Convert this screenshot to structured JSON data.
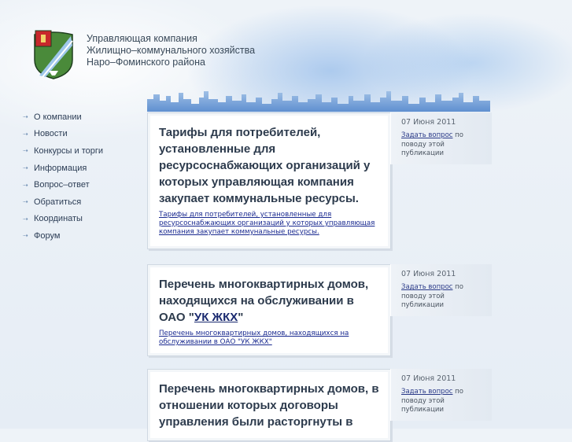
{
  "header": {
    "org_line1": "Управляющая компания",
    "org_line2": "Жилищно–коммунального хозяйства",
    "org_line3": "Наро–Фоминского района"
  },
  "nav": {
    "items": [
      {
        "label": "О компании"
      },
      {
        "label": "Новости"
      },
      {
        "label": "Конкурсы и торги"
      },
      {
        "label": "Информация"
      },
      {
        "label": "Вопрос–ответ"
      },
      {
        "label": "Обратиться"
      },
      {
        "label": "Координаты"
      },
      {
        "label": "Форум"
      }
    ]
  },
  "articles": [
    {
      "title": "Тарифы для потребителей, установленные для ресурсоснабжающих организаций у которых управляющая компания закупает коммунальные ресурсы.",
      "link": "Тарифы для потребителей, установленные для ресурсоснабжающих организаций у которых управляющая компания закупает коммунальные ресурсы.",
      "date": "07 Июня 2011",
      "ask_link": "Задать вопрос",
      "ask_rest": "по поводу этой публикации"
    },
    {
      "title_prefix": "Перечень многоквартирных домов, находящихся на обслуживании в ОАО \"",
      "title_link": "УК ЖКХ",
      "title_suffix": "\"",
      "link": "Перечень многоквартирных домов, находящихся на обслуживании в ОАО \"УК ЖКХ\"",
      "date": "07 Июня 2011",
      "ask_link": "Задать вопрос",
      "ask_rest": "по поводу этой публикации"
    },
    {
      "title": "Перечень многоквартирных домов, в отношении которых договоры управления были расторгнуты в",
      "date": "07 Июня 2011",
      "ask_link": "Задать вопрос",
      "ask_rest": "по поводу этой публикации"
    }
  ],
  "colors": {
    "title": "#2d3b4d",
    "link": "#1a2a90",
    "nav_text": "#2c3d55",
    "crest_green": "#2e8b3e",
    "crest_red": "#c8282c"
  }
}
